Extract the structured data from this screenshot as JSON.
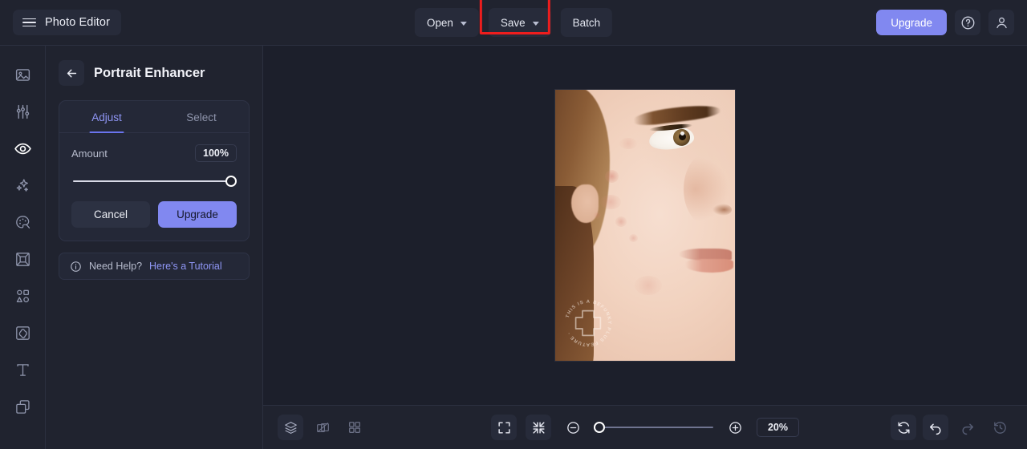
{
  "header": {
    "menu_icon": "hamburger-icon",
    "app_title": "Photo Editor",
    "tools": [
      {
        "label": "Open",
        "icon": "chevron-down-icon",
        "has_caret": true
      },
      {
        "label": "Save",
        "icon": "chevron-down-icon",
        "has_caret": true,
        "highlighted": true
      },
      {
        "label": "Batch",
        "has_caret": false
      }
    ],
    "upgrade_label": "Upgrade",
    "help_icon": "question-circle-icon",
    "account_icon": "user-icon",
    "highlight_color": "#ee1d1d",
    "accent_color": "#8188f0"
  },
  "rail": {
    "items": [
      {
        "name": "image",
        "icon": "image-icon",
        "active": false
      },
      {
        "name": "adjust",
        "icon": "sliders-icon",
        "active": false
      },
      {
        "name": "retouch",
        "icon": "eye-icon",
        "active": true
      },
      {
        "name": "effects",
        "icon": "sparkles-icon",
        "active": false
      },
      {
        "name": "artsy",
        "icon": "palette-icon",
        "active": false
      },
      {
        "name": "frames",
        "icon": "frame-icon",
        "active": false
      },
      {
        "name": "graphics",
        "icon": "shapes-icon",
        "active": false
      },
      {
        "name": "overlays",
        "icon": "mask-icon",
        "active": false
      },
      {
        "name": "text",
        "icon": "text-icon",
        "active": false
      },
      {
        "name": "layers",
        "icon": "layers-stack-icon",
        "active": false
      }
    ]
  },
  "panel": {
    "back_icon": "arrow-left-icon",
    "title": "Portrait Enhancer",
    "tabs": [
      {
        "label": "Adjust",
        "active": true
      },
      {
        "label": "Select",
        "active": false
      }
    ],
    "amount_label": "Amount",
    "amount_value": "100%",
    "slider_percent": 100,
    "cancel_label": "Cancel",
    "upgrade_label": "Upgrade",
    "help": {
      "icon": "info-circle-icon",
      "text": "Need Help? ",
      "link": "Here's a Tutorial"
    }
  },
  "canvas": {
    "image_alt": "Close-up portrait of a woman's face with blemishes on cheek",
    "watermark_text": "THIS IS A BEFUNKY PLUS FEATURE",
    "watermark_icon": "plus-badge-icon"
  },
  "bottombar": {
    "left_tools": [
      {
        "name": "layers",
        "icon": "layers-stack-icon",
        "active": true
      },
      {
        "name": "compare",
        "icon": "compare-split-icon",
        "active": false
      },
      {
        "name": "grid",
        "icon": "grid-icon",
        "active": false
      }
    ],
    "center_tools": [
      {
        "name": "fit-screen",
        "icon": "expand-corners-icon"
      },
      {
        "name": "actual-size",
        "icon": "collapse-corners-icon"
      },
      {
        "name": "zoom-out",
        "icon": "minus-circle-icon"
      },
      {
        "name": "zoom-in",
        "icon": "plus-circle-icon"
      }
    ],
    "zoom_value": "20%",
    "zoom_slider_percent": 0,
    "right_tools": [
      {
        "name": "reset",
        "icon": "refresh-icon",
        "active": true
      },
      {
        "name": "undo",
        "icon": "undo-arrow-icon",
        "active": true
      },
      {
        "name": "redo",
        "icon": "redo-arrow-icon",
        "active": false
      },
      {
        "name": "history",
        "icon": "history-clock-icon",
        "active": false
      }
    ]
  }
}
